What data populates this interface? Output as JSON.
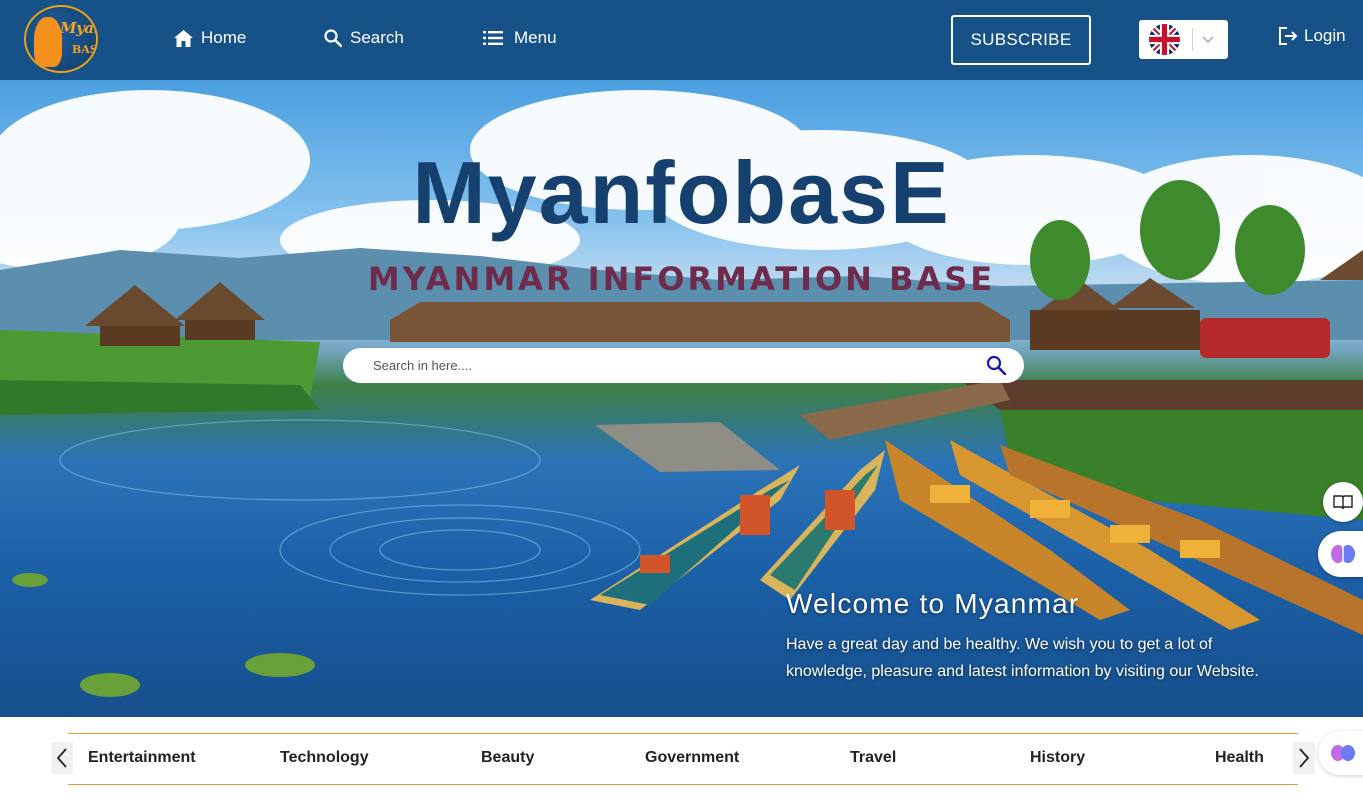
{
  "navbar": {
    "logo_text_top": "Myanfo",
    "logo_text_bottom": "BASE",
    "home_label": "Home",
    "search_label": "Search",
    "menu_label": "Menu",
    "subscribe_label": "SUBSCRIBE",
    "language": "English (UK)",
    "login_label": "Login"
  },
  "hero": {
    "title": "MyanfobasE",
    "subtitle": "MYANMAR INFORMATION BASE",
    "search_placeholder": "Search in here....",
    "welcome_title": "Welcome to Myanmar",
    "welcome_text": "Have a great day and be healthy. We wish you to get a lot of knowledge, pleasure and latest information by visiting our Website."
  },
  "categories": [
    "Entertainment",
    "Technology",
    "Beauty",
    "Government",
    "Travel",
    "History",
    "Health"
  ],
  "icons": {
    "home": "home-icon",
    "search": "search-icon",
    "menu": "list-icon",
    "login": "login-icon",
    "flag": "uk-flag-icon",
    "chevron": "chevron-down-icon",
    "reader": "book-icon",
    "ai": "brain-icon",
    "prev": "chevron-left-icon",
    "next": "chevron-right-icon"
  },
  "colors": {
    "navbar": "#165188",
    "title": "#16416f",
    "subtitle": "#6f2b4c",
    "accent_line": "#e39c3b",
    "logo_gold": "#f6a31f"
  }
}
